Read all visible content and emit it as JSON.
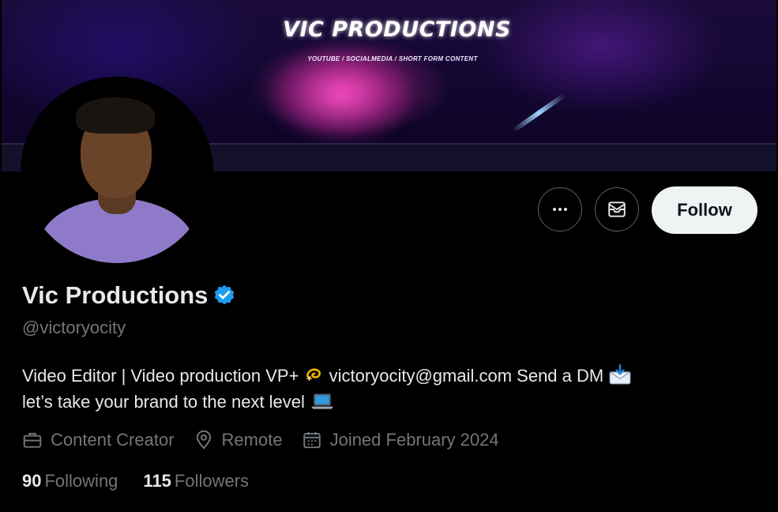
{
  "banner": {
    "title": "VIC PRODUCTIONS",
    "subtitle": "YOUTUBE / SOCIALMEDIA / SHORT FORM CONTENT"
  },
  "actions": {
    "more_icon": "more-horizontal-icon",
    "message_icon": "envelope-icon",
    "follow_label": "Follow"
  },
  "profile": {
    "display_name": "Vic Productions",
    "verified": true,
    "handle": "@victoryocity",
    "bio_line1_a": "Video Editor | Video production VP+",
    "bio_line1_b": "victoryocity@gmail.com   Send a DM",
    "bio_line2": "let’s take your brand to the next level",
    "category": "Content Creator",
    "location": "Remote",
    "joined": "Joined February 2024"
  },
  "stats": {
    "following_count": "90",
    "following_label": "Following",
    "followers_count": "115",
    "followers_label": "Followers"
  },
  "colors": {
    "background": "#000000",
    "text_primary": "#e7e9ea",
    "text_secondary": "#71767b",
    "verified_blue": "#1d9bf0",
    "follow_bg": "#eff3f4"
  }
}
